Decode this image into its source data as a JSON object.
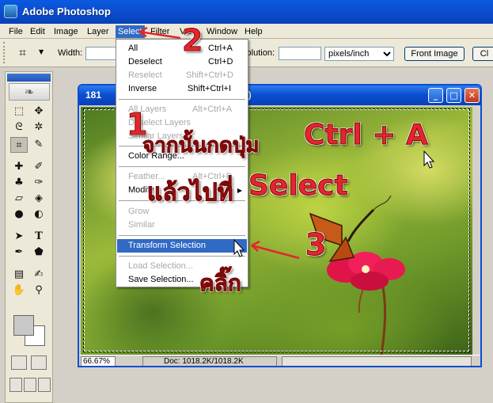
{
  "app": {
    "title": "Adobe Photoshop"
  },
  "menubar": {
    "items": [
      "File",
      "Edit",
      "Image",
      "Layer",
      "Select",
      "Filter",
      "View",
      "Window",
      "Help"
    ],
    "active": "Select"
  },
  "options": {
    "width_label": "Width:",
    "resolution_label": "Resolution:",
    "units_value": "pixels/inch",
    "front_image_label": "Front Image",
    "clear_label": "Cl"
  },
  "select_menu": [
    {
      "label": "All",
      "shortcut": "Ctrl+A",
      "enabled": true
    },
    {
      "label": "Deselect",
      "shortcut": "Ctrl+D",
      "enabled": true
    },
    {
      "label": "Reselect",
      "shortcut": "Shift+Ctrl+D",
      "enabled": false
    },
    {
      "label": "Inverse",
      "shortcut": "Shift+Ctrl+I",
      "enabled": true
    },
    {
      "label": "All Layers",
      "shortcut": "Alt+Ctrl+A",
      "enabled": false
    },
    {
      "label": "Deselect Layers",
      "shortcut": "",
      "enabled": false
    },
    {
      "label": "Similar Layers",
      "shortcut": "",
      "enabled": false
    },
    {
      "label": "Color Range...",
      "shortcut": "",
      "enabled": true
    },
    {
      "label": "Feather...",
      "shortcut": "Alt+Ctrl+D",
      "enabled": false
    },
    {
      "label": "Modify",
      "shortcut": "",
      "enabled": true,
      "submenu": true
    },
    {
      "label": "Grow",
      "shortcut": "",
      "enabled": false
    },
    {
      "label": "Similar",
      "shortcut": "",
      "enabled": false
    },
    {
      "label": "Transform Selection",
      "shortcut": "",
      "enabled": true,
      "highlighted": true
    },
    {
      "label": "Load Selection...",
      "shortcut": "",
      "enabled": false
    },
    {
      "label": "Save Selection...",
      "shortcut": "",
      "enabled": true
    }
  ],
  "document": {
    "title_prefix": "181",
    "title_suffix": "#)",
    "zoom": "66.67%",
    "doc_size": "Doc: 1018.2K/1018.2K"
  },
  "annotations": {
    "step1": "1",
    "step1_text": "จากนั้นกดปุ่ม",
    "ctrl_a": "Ctrl + A",
    "then_go_to": "แล้วไปที่",
    "select_word": "Select",
    "step2": "2",
    "step3": "3",
    "click_text": "คลิ๊ก",
    "color": "#e3262c"
  },
  "icons": [
    "photoshop-logo-icon",
    "crop-icon",
    "feather-icon",
    "marquee-icon",
    "move-icon",
    "lasso-icon",
    "magic-wand-icon",
    "crop-tool-icon",
    "slice-icon",
    "healing-icon",
    "brush-icon",
    "stamp-icon",
    "history-brush-icon",
    "eraser-icon",
    "bucket-icon",
    "blur-icon",
    "dodge-icon",
    "path-select-icon",
    "type-icon",
    "pen-icon",
    "shape-icon",
    "notes-icon",
    "eyedropper-icon",
    "hand-icon",
    "zoom-icon",
    "minimize-icon",
    "maximize-icon",
    "close-icon",
    "cursor-icon"
  ]
}
